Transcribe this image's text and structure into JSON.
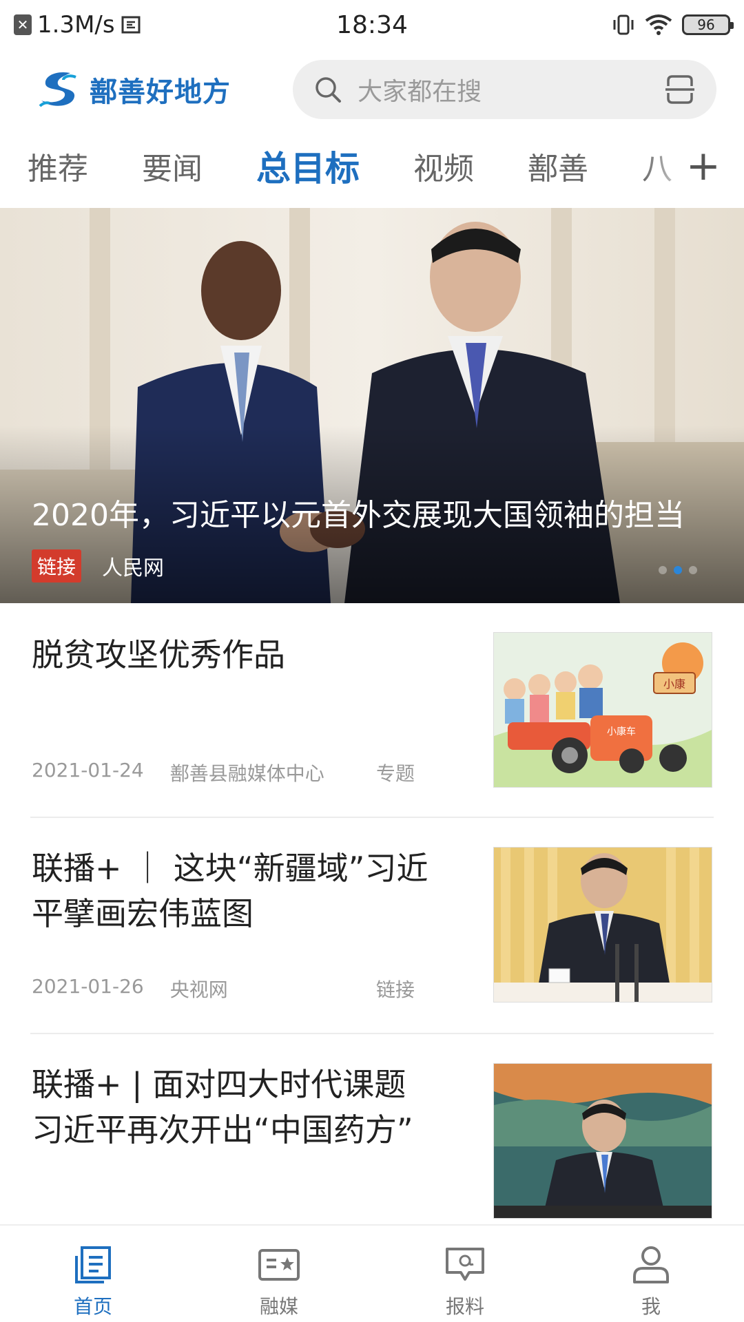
{
  "status_bar": {
    "speed": "1.3M/s",
    "time": "18:34",
    "battery": "96",
    "icons": [
      "close-notification-icon",
      "screen-record-icon",
      "vibrate-icon",
      "wifi-icon",
      "battery-icon"
    ]
  },
  "header": {
    "app_name": "鄯善好地方",
    "search_placeholder": "大家都在搜",
    "icons": [
      "search-icon",
      "scan-icon"
    ]
  },
  "tabs": {
    "items": [
      "推荐",
      "要闻",
      "总目标",
      "视频",
      "鄯善",
      "八"
    ],
    "active_index": 2,
    "more_label": "+"
  },
  "hero": {
    "title": "2020年，习近平以元首外交展现大国领袖的担当",
    "badge": "链接",
    "source": "人民网",
    "slide_count": 3,
    "active_slide": 1
  },
  "feed": {
    "items": [
      {
        "title": "脱贫攻坚优秀作品",
        "date": "2021-01-24",
        "source": "鄯善县融媒体中心",
        "tag": "专题"
      },
      {
        "title": "联播+ ｜ 这块“新疆域”习近平擘画宏伟蓝图",
        "date": "2021-01-26",
        "source": "央视网",
        "tag": "链接"
      },
      {
        "title": "联播+ | 面对四大时代课题 习近平再次开出“中国药方”",
        "date": "",
        "source": "",
        "tag": ""
      }
    ],
    "thumb_captions": [
      "小康",
      "小康车"
    ]
  },
  "bottom_nav": {
    "items": [
      {
        "label": "首页",
        "icon": "home-icon"
      },
      {
        "label": "融媒",
        "icon": "media-icon"
      },
      {
        "label": "报料",
        "icon": "report-icon"
      },
      {
        "label": "我",
        "icon": "profile-icon"
      }
    ],
    "active_index": 0
  },
  "colors": {
    "accent": "#1e6fbf",
    "badge_red": "#d33b2c"
  }
}
